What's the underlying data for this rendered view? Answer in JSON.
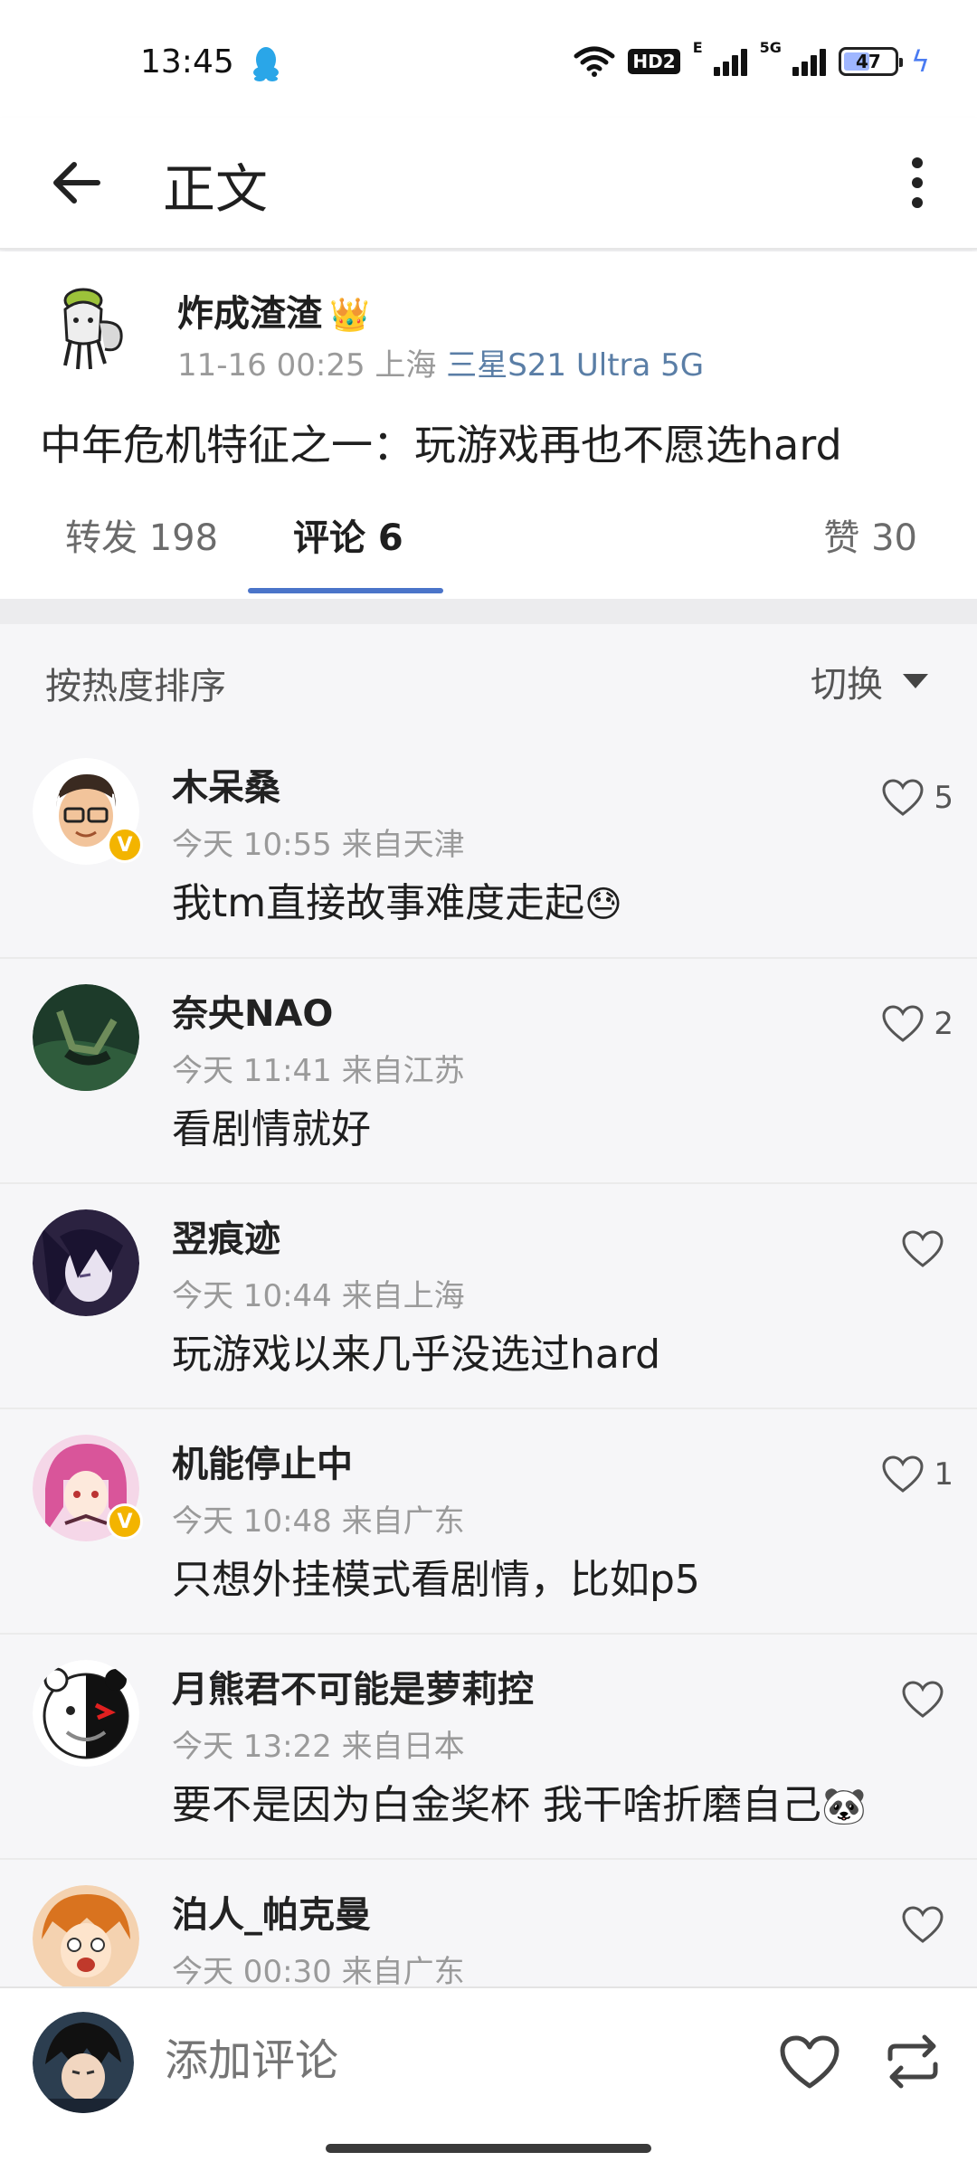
{
  "status_bar": {
    "time": "13:45",
    "hd_label": "HD2",
    "net_label_1": "E",
    "net_label_2": "5G",
    "battery": "47"
  },
  "header": {
    "title": "正文"
  },
  "post": {
    "author": "炸成渣渣",
    "timestamp": "11-16 00:25",
    "location": "上海",
    "device": "三星S21 Ultra 5G",
    "text": "中年危机特征之一：玩游戏再也不愿选hard"
  },
  "tabs": [
    {
      "label": "转发 198"
    },
    {
      "label": "评论 6"
    },
    {
      "label": "赞 30"
    }
  ],
  "sort": {
    "label": "按热度排序",
    "switch_label": "切换"
  },
  "comments": [
    {
      "name": "木呆桑",
      "meta": "今天 10:55 来自天津",
      "text": "我tm直接故事难度走起",
      "emoji": "😓",
      "likes": "5",
      "verified": true
    },
    {
      "name": "奈央NAO",
      "meta": "今天 11:41 来自江苏",
      "text": "看剧情就好",
      "emoji": "",
      "likes": "2",
      "verified": false
    },
    {
      "name": "翌痕迹",
      "meta": "今天 10:44 来自上海",
      "text": "玩游戏以来几乎没选过hard",
      "emoji": "",
      "likes": "",
      "verified": false
    },
    {
      "name": "机能停止中",
      "meta": "今天 10:48 来自广东",
      "text": "只想外挂模式看剧情，比如p5",
      "emoji": "",
      "likes": "1",
      "verified": true
    },
    {
      "name": "月熊君不可能是萝莉控",
      "meta": "今天 13:22 来自日本",
      "text": "要不是因为白金奖杯 我干啥折磨自己",
      "emoji": "🐼",
      "likes": "",
      "verified": false
    },
    {
      "name": "泊人_帕克曼",
      "meta": "今天 00:30 来自广东",
      "text": "",
      "emoji": "",
      "likes": "",
      "verified": false
    }
  ],
  "bottom_bar": {
    "placeholder": "添加评论"
  },
  "colors": {
    "accent": "#4a74c9",
    "device_link": "#5a7ea6",
    "verified": "#f3b400"
  }
}
